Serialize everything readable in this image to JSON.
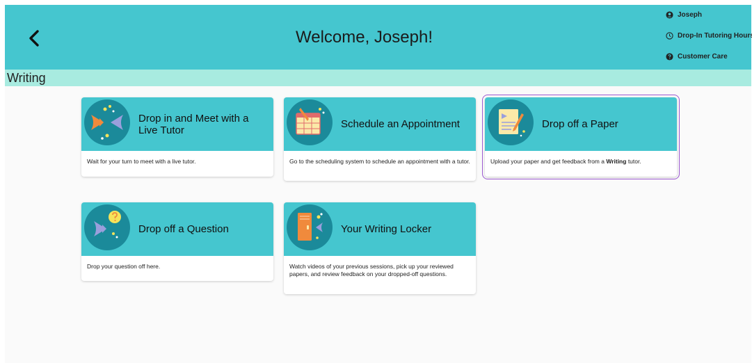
{
  "header": {
    "title": "Welcome, Joseph!",
    "user_menu": [
      {
        "label": "Joseph",
        "icon": "user-circle-icon"
      },
      {
        "label": "Drop-In Tutoring Hours",
        "icon": "clock-icon"
      },
      {
        "label": "Customer Care",
        "icon": "question-circle-icon"
      }
    ]
  },
  "section": {
    "title": "Writing"
  },
  "cards": [
    {
      "title": "Drop in and Meet with a Live Tutor",
      "description": "Wait for your turn to meet with a live tutor.",
      "icon": "fish-meeting-icon"
    },
    {
      "title": "Schedule an Appointment",
      "description": "Go to the scheduling system to schedule an appointment with a tutor.",
      "icon": "calendar-pencil-icon"
    },
    {
      "title": "Drop off a Paper",
      "description_before": "Upload your paper and get feedback from a ",
      "description_bold": "Writing",
      "description_after": " tutor.",
      "icon": "paper-pencil-icon"
    },
    {
      "title": "Drop off a Question",
      "description": "Drop your question off here.",
      "icon": "fish-question-icon"
    },
    {
      "title": "Your Writing Locker",
      "description": "Watch videos of your previous sessions, pick up your reviewed papers, and review feedback on your dropped-off questions.",
      "icon": "locker-icon"
    }
  ],
  "colors": {
    "header": "#45c6cf",
    "subheader": "#a8ebe0",
    "selected_outline": "#9b59d0"
  }
}
